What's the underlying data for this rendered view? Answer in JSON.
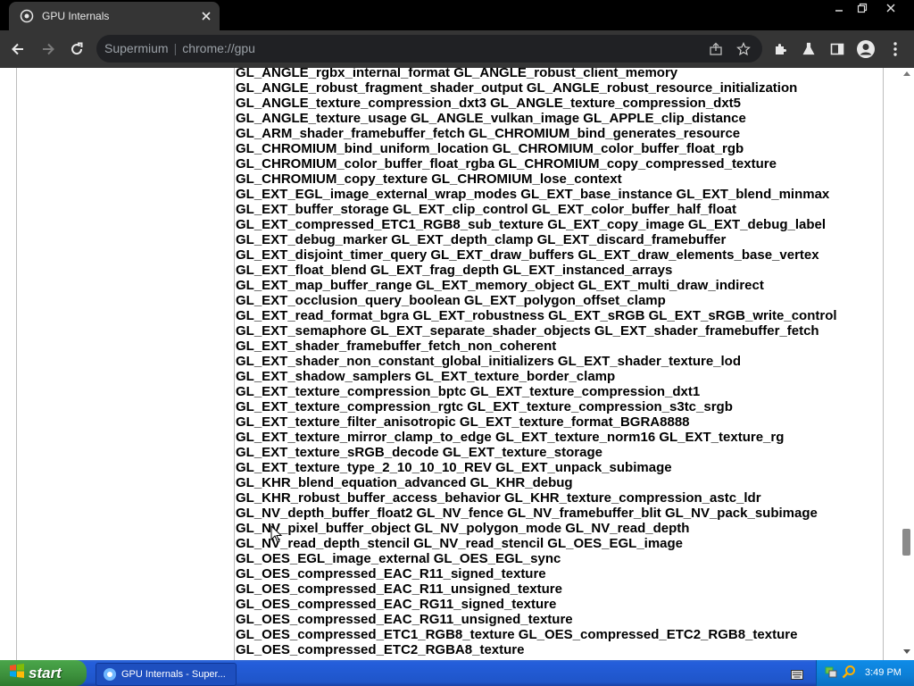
{
  "tab": {
    "title": "GPU Internals"
  },
  "omnibox": {
    "site": "Supermium",
    "separator": "|",
    "url": "chrome://gpu"
  },
  "extensions": [
    "GL_ANGLE_rgbx_internal_format GL_ANGLE_robust_client_memory",
    "GL_ANGLE_robust_fragment_shader_output GL_ANGLE_robust_resource_initialization",
    "GL_ANGLE_texture_compression_dxt3 GL_ANGLE_texture_compression_dxt5",
    "GL_ANGLE_texture_usage GL_ANGLE_vulkan_image GL_APPLE_clip_distance",
    "GL_ARM_shader_framebuffer_fetch GL_CHROMIUM_bind_generates_resource",
    "GL_CHROMIUM_bind_uniform_location GL_CHROMIUM_color_buffer_float_rgb",
    "GL_CHROMIUM_color_buffer_float_rgba GL_CHROMIUM_copy_compressed_texture",
    "GL_CHROMIUM_copy_texture GL_CHROMIUM_lose_context",
    "GL_EXT_EGL_image_external_wrap_modes GL_EXT_base_instance GL_EXT_blend_minmax",
    "GL_EXT_buffer_storage GL_EXT_clip_control GL_EXT_color_buffer_half_float",
    "GL_EXT_compressed_ETC1_RGB8_sub_texture GL_EXT_copy_image GL_EXT_debug_label",
    "GL_EXT_debug_marker GL_EXT_depth_clamp GL_EXT_discard_framebuffer",
    "GL_EXT_disjoint_timer_query GL_EXT_draw_buffers GL_EXT_draw_elements_base_vertex",
    "GL_EXT_float_blend GL_EXT_frag_depth GL_EXT_instanced_arrays",
    "GL_EXT_map_buffer_range GL_EXT_memory_object GL_EXT_multi_draw_indirect",
    "GL_EXT_occlusion_query_boolean GL_EXT_polygon_offset_clamp",
    "GL_EXT_read_format_bgra GL_EXT_robustness GL_EXT_sRGB GL_EXT_sRGB_write_control",
    "GL_EXT_semaphore GL_EXT_separate_shader_objects GL_EXT_shader_framebuffer_fetch",
    "GL_EXT_shader_framebuffer_fetch_non_coherent",
    "GL_EXT_shader_non_constant_global_initializers GL_EXT_shader_texture_lod",
    "GL_EXT_shadow_samplers GL_EXT_texture_border_clamp",
    "GL_EXT_texture_compression_bptc GL_EXT_texture_compression_dxt1",
    "GL_EXT_texture_compression_rgtc GL_EXT_texture_compression_s3tc_srgb",
    "GL_EXT_texture_filter_anisotropic GL_EXT_texture_format_BGRA8888",
    "GL_EXT_texture_mirror_clamp_to_edge GL_EXT_texture_norm16 GL_EXT_texture_rg",
    "GL_EXT_texture_sRGB_decode GL_EXT_texture_storage",
    "GL_EXT_texture_type_2_10_10_10_REV GL_EXT_unpack_subimage",
    "GL_KHR_blend_equation_advanced GL_KHR_debug",
    "GL_KHR_robust_buffer_access_behavior GL_KHR_texture_compression_astc_ldr",
    "GL_NV_depth_buffer_float2 GL_NV_fence GL_NV_framebuffer_blit GL_NV_pack_subimage",
    "GL_NV_pixel_buffer_object GL_NV_polygon_mode GL_NV_read_depth",
    "GL_NV_read_depth_stencil GL_NV_read_stencil GL_OES_EGL_image",
    "GL_OES_EGL_image_external GL_OES_EGL_sync",
    "GL_OES_compressed_EAC_R11_signed_texture",
    "GL_OES_compressed_EAC_R11_unsigned_texture",
    "GL_OES_compressed_EAC_RG11_signed_texture",
    "GL_OES_compressed_EAC_RG11_unsigned_texture",
    "GL_OES_compressed_ETC1_RGB8_texture GL_OES_compressed_ETC2_RGB8_texture",
    "GL_OES_compressed_ETC2_RGBA8_texture"
  ],
  "taskbar": {
    "start_label": "start",
    "task_label": "GPU Internals - Super...",
    "clock": "3:49 PM"
  },
  "colors": {
    "tab_strip": "#000000",
    "toolbar": "#353535",
    "omnibox": "#202124",
    "taskbar": "#245edb",
    "start": "#3c8f3c",
    "tray": "#0c7fd6"
  },
  "icons": [
    "globe-icon",
    "close-icon",
    "minimize-icon",
    "restore-icon",
    "back-icon",
    "forward-icon",
    "reload-icon",
    "share-icon",
    "star-icon",
    "puzzle-icon",
    "flask-icon",
    "sidepanel-icon",
    "profile-icon",
    "menu-icon",
    "windows-flag-icon",
    "keyboard-icon",
    "network-icon",
    "search-icon"
  ]
}
